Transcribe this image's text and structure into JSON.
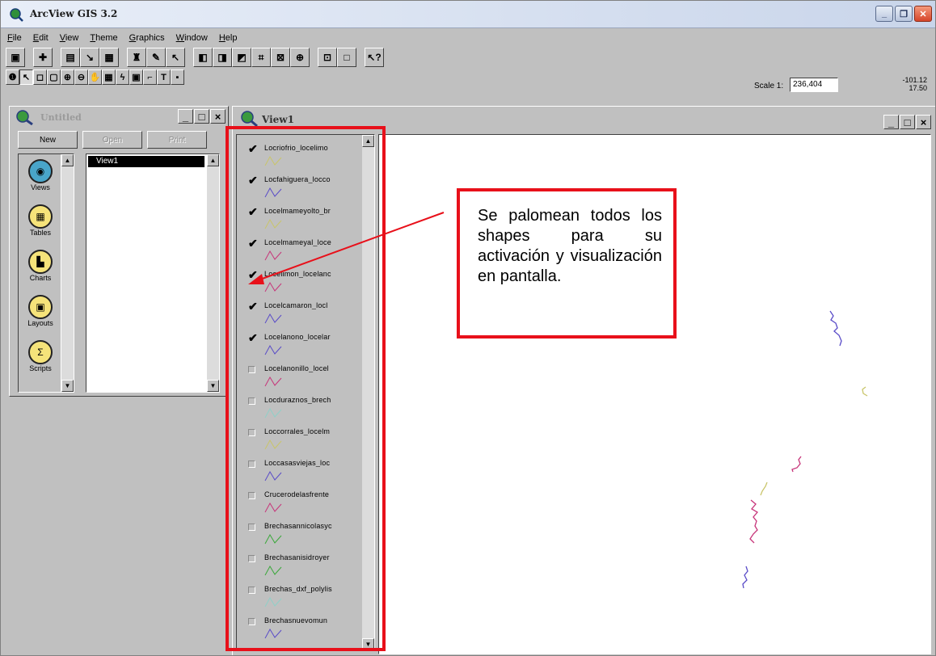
{
  "window": {
    "title": "ArcView GIS 3.2",
    "minimize_icon": "_",
    "restore_icon": "❐",
    "close_icon": "✕"
  },
  "menu": [
    "File",
    "Edit",
    "View",
    "Theme",
    "Graphics",
    "Window",
    "Help"
  ],
  "scale": {
    "label": "Scale 1:",
    "value": "236,404"
  },
  "coords": {
    "x": "-101.12",
    "y": "17.50"
  },
  "project": {
    "title": "Untitled",
    "buttons": {
      "new": "New",
      "open": "Open",
      "print": "Print"
    },
    "doc_types": [
      "Views",
      "Tables",
      "Charts",
      "Layouts",
      "Scripts"
    ],
    "documents": [
      "View1"
    ]
  },
  "view": {
    "title": "View1",
    "themes": [
      {
        "name": "Locriofrio_locelimo",
        "checked": true,
        "color": "#c9c56a"
      },
      {
        "name": "Locfahiguera_locco",
        "checked": true,
        "color": "#5a4cc8"
      },
      {
        "name": "Locelmameyolto_br",
        "checked": true,
        "color": "#c9c56a"
      },
      {
        "name": "Locelmameyal_loce",
        "checked": true,
        "color": "#c7357a"
      },
      {
        "name": "Locelimon_locelanc",
        "checked": true,
        "color": "#c7357a"
      },
      {
        "name": "Locelcamaron_locl",
        "checked": true,
        "color": "#5a4cc8"
      },
      {
        "name": "Locelanono_locelar",
        "checked": true,
        "color": "#5a4cc8"
      },
      {
        "name": "Locelanonillo_locel",
        "checked": false,
        "color": "#c7357a"
      },
      {
        "name": "Locduraznos_brech",
        "checked": false,
        "color": "#8fd0c8"
      },
      {
        "name": "Loccorrales_locelm",
        "checked": false,
        "color": "#c9c56a"
      },
      {
        "name": "Loccasasviejas_loc",
        "checked": false,
        "color": "#5a4cc8"
      },
      {
        "name": "Crucerodelasfrente",
        "checked": false,
        "color": "#c7357a"
      },
      {
        "name": "Brechasannicolasyc",
        "checked": false,
        "color": "#3aa83a"
      },
      {
        "name": "Brechasanisidroyer",
        "checked": false,
        "color": "#3aa83a"
      },
      {
        "name": "Brechas_dxf_polylis",
        "checked": false,
        "color": "#8fd0c8"
      },
      {
        "name": "Brechasnuevomun",
        "checked": false,
        "color": "#5a4cc8"
      }
    ]
  },
  "annotation": {
    "text": "Se palomean todos los shapes para su activación y visualización en pantalla.",
    "border_color": "#e8101a"
  },
  "icons": {
    "app": "arcview-globe-icon",
    "check": "✔"
  }
}
